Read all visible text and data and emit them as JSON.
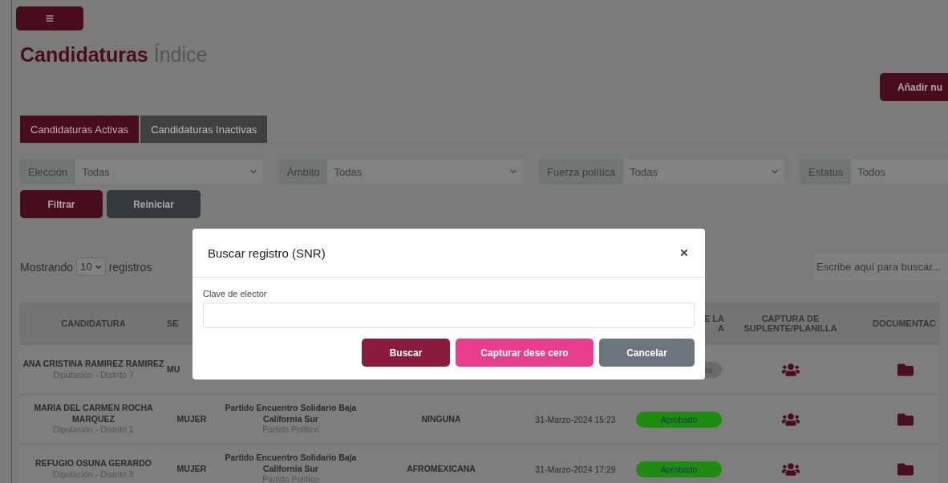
{
  "page_title": {
    "main": "Candidaturas",
    "sub": "Índice"
  },
  "add_button": {
    "label": "Añadir nu"
  },
  "tabs": [
    {
      "label": "Candidaturas Activas",
      "selected": true
    },
    {
      "label": "Candidaturas Inactivas",
      "selected": false
    }
  ],
  "filters": [
    {
      "label": "Elección",
      "value": "Todas"
    },
    {
      "label": "Ámbito",
      "value": "Todas"
    },
    {
      "label": "Fuerza política",
      "value": "Todas"
    },
    {
      "label": "Estatus",
      "value": "Todos"
    }
  ],
  "filter_buttons": [
    {
      "label": "Filtrar",
      "kind": "primary"
    },
    {
      "label": "Reiniciar",
      "kind": "secondary"
    }
  ],
  "page_size": {
    "prefix": "Mostrando",
    "value": "10",
    "suffix": "registros"
  },
  "search": {
    "placeholder": "Escribe aquí para buscar..."
  },
  "table": {
    "columns": [
      {
        "lines": [
          "CANDIDATURA"
        ]
      },
      {
        "lines": [
          "SE"
        ]
      },
      {},
      {},
      {},
      {
        "lines": [
          "E LA",
          "A"
        ]
      },
      {
        "lines": [
          "CAPTURA DE",
          "SUPLENTE/PLANILLA"
        ]
      },
      {
        "lines": [
          "DOCUMENTAC"
        ]
      }
    ],
    "rows": [
      {
        "name": "ANA CRISTINA RAMIREZ RAMIREZ",
        "district": "Diputación - Distrito 7",
        "sex": "MU",
        "status": {
          "label": "ra",
          "color": "#6a6a6a"
        }
      },
      {
        "name": "MARIA DEL CARMEN ROCHA MARQUEZ",
        "district": "Diputación - Distrito 1",
        "sex": "MUJER",
        "party": "Partido Encuentro Solidario Baja California Sur",
        "party_type": "Partido Político",
        "affirmative": "NINGUNA",
        "date": "31-Marzo-2024 15:23",
        "status": {
          "label": "Aprobado",
          "color": "#1f8a10"
        }
      },
      {
        "name": "REFUGIO OSUNA GERARDO",
        "district": "Diputación - Distrito 8",
        "sex": "MUJER",
        "party": "Partido Encuentro Solidario Baja California Sur",
        "party_type": "Partido Político",
        "affirmative": "AFROMEXICANA",
        "date": "31-Marzo-2024 17:29",
        "status": {
          "label": "Aprobado",
          "color": "#1f8a10"
        }
      }
    ]
  },
  "modal": {
    "title": "Buscar registro (SNR)",
    "field_label": "Clave de elector",
    "buttons": [
      {
        "label": "Buscar",
        "kind": "primary"
      },
      {
        "label": "Capturar dese cero",
        "kind": "accent"
      },
      {
        "label": "Cancelar",
        "kind": "secondary"
      }
    ]
  }
}
